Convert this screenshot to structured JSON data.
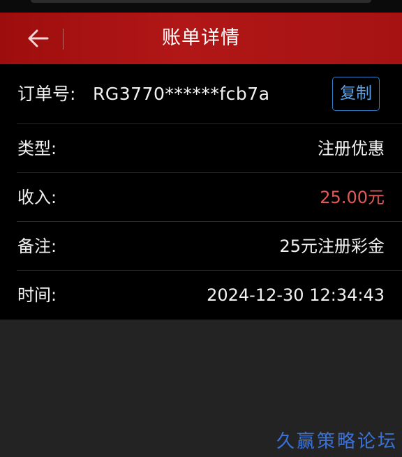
{
  "header": {
    "title": "账单详情",
    "back_icon": "arrow-left-icon"
  },
  "order": {
    "label": "订单号:",
    "value": "RG3770******fcb7a",
    "copy_label": "复制"
  },
  "details": {
    "type": {
      "label": "类型:",
      "value": "注册优惠"
    },
    "income": {
      "label": "收入:",
      "value": "25.00元"
    },
    "remark": {
      "label": "备注:",
      "value": "25元注册彩金"
    },
    "time": {
      "label": "时间:",
      "value": "2024-12-30 12:34:43"
    }
  },
  "watermark": "久赢策略论坛",
  "colors": {
    "header_red": "#b11717",
    "income_red": "#e05a55",
    "copy_blue": "#5aa3e8",
    "watermark_blue": "#3a72d8"
  }
}
